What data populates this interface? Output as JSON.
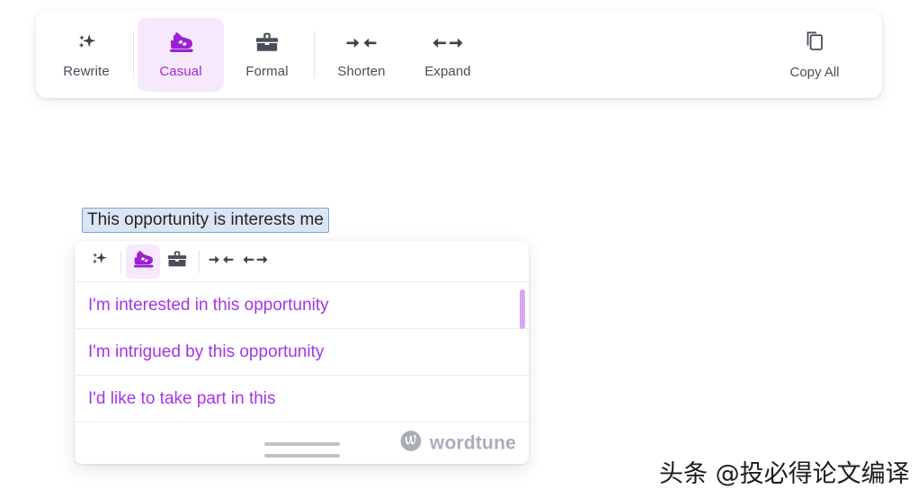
{
  "main_toolbar": {
    "buttons": [
      {
        "label": "Rewrite",
        "icon": "sparkles-icon",
        "active": false
      },
      {
        "label": "Casual",
        "icon": "sneaker-icon",
        "active": true
      },
      {
        "label": "Formal",
        "icon": "briefcase-icon",
        "active": false
      },
      {
        "label": "Shorten",
        "icon": "arrows-inward-icon",
        "active": false
      },
      {
        "label": "Expand",
        "icon": "arrows-outward-icon",
        "active": false
      }
    ],
    "copy_all": {
      "label": "Copy All",
      "icon": "copy-icon"
    }
  },
  "editor": {
    "selected_text": "This opportunity is interests me"
  },
  "popup": {
    "mini_toolbar": [
      {
        "icon": "sparkles-icon",
        "name": "rewrite",
        "active": false
      },
      {
        "icon": "sneaker-icon",
        "name": "casual",
        "active": true
      },
      {
        "icon": "briefcase-icon",
        "name": "formal",
        "active": false
      },
      {
        "icon": "arrows-inward-icon",
        "name": "shorten",
        "active": false
      },
      {
        "icon": "arrows-outward-icon",
        "name": "expand",
        "active": false
      }
    ],
    "suggestions": [
      "I'm interested in this opportunity",
      "I'm intrigued by this opportunity",
      "I'd like to take part in this"
    ],
    "brand": {
      "name": "wordtune",
      "logo": "wordtune-logo-icon"
    }
  },
  "watermark": {
    "text": "头条 @投必得论文编译"
  },
  "colors": {
    "accent_purple": "#a435e8",
    "accent_purple_dark": "#a327d6",
    "accent_bg": "#f7e9fd",
    "text_dark": "#4a4d58",
    "selection_bg": "#dbe5f4",
    "selection_border": "#7ba3d8",
    "brand_gray": "#a9adb6",
    "scrollbar_thumb": "#d7a6ee"
  }
}
